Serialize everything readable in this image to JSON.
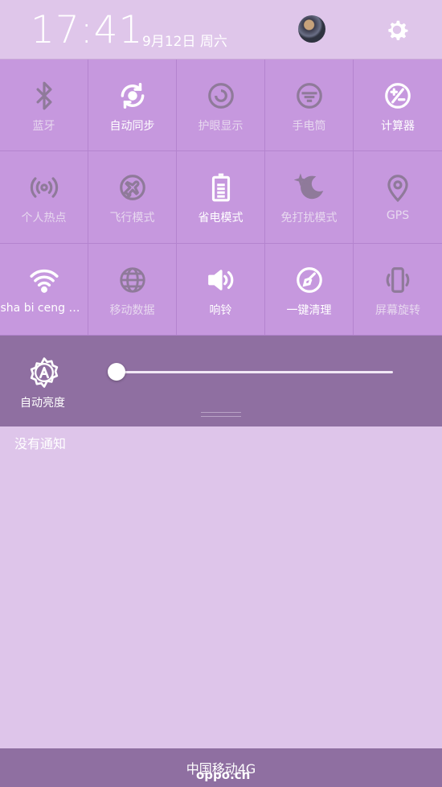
{
  "status_bar": {
    "time": "17:41",
    "date": "9月12日 周六"
  },
  "quick_settings": [
    {
      "label": "蓝牙",
      "icon": "bluetooth-icon",
      "state": "off"
    },
    {
      "label": "自动同步",
      "icon": "sync-icon",
      "state": "on"
    },
    {
      "label": "护眼显示",
      "icon": "eye-protection-icon",
      "state": "off"
    },
    {
      "label": "手电筒",
      "icon": "flashlight-icon",
      "state": "off"
    },
    {
      "label": "计算器",
      "icon": "calculator-icon",
      "state": "on"
    },
    {
      "label": "个人热点",
      "icon": "hotspot-icon",
      "state": "off"
    },
    {
      "label": "飞行模式",
      "icon": "airplane-icon",
      "state": "off"
    },
    {
      "label": "省电模式",
      "icon": "battery-icon",
      "state": "on"
    },
    {
      "label": "免打扰模式",
      "icon": "moon-icon",
      "state": "off"
    },
    {
      "label": "GPS",
      "icon": "location-icon",
      "state": "off"
    },
    {
      "label": "sha bi ceng w...",
      "icon": "wifi-icon",
      "state": "on"
    },
    {
      "label": "移动数据",
      "icon": "globe-icon",
      "state": "off"
    },
    {
      "label": "响铃",
      "icon": "speaker-icon",
      "state": "on"
    },
    {
      "label": "一键清理",
      "icon": "broom-icon",
      "state": "on"
    },
    {
      "label": "屏幕旋转",
      "icon": "rotate-icon",
      "state": "off"
    }
  ],
  "brightness": {
    "auto_label": "自动亮度",
    "level": 0.0
  },
  "notifications": {
    "empty_text": "没有通知"
  },
  "carrier": "中国移动4G",
  "watermark": "oppo.cn",
  "colors": {
    "panel_bg": "#c698de",
    "brightness_bg": "#8f6fa1",
    "notification_bg": "#dec5ea",
    "icon_off": "#8f7a9a",
    "icon_on": "#ffffff"
  }
}
